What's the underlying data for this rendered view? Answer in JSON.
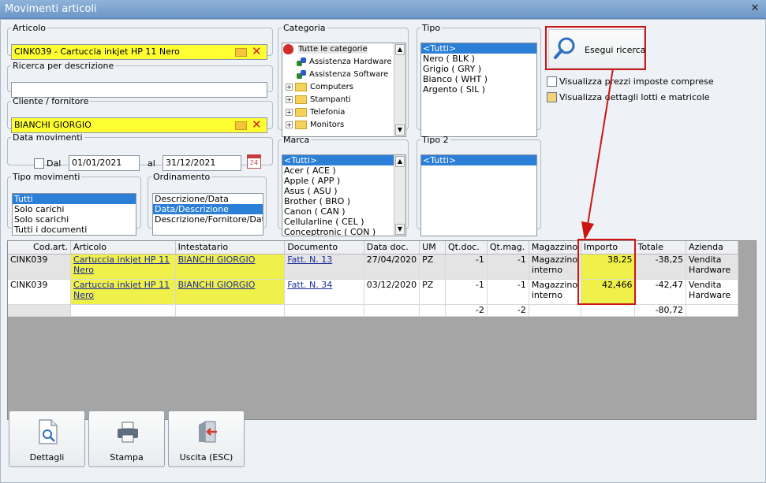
{
  "window": {
    "title": "Movimenti articoli",
    "close_glyph": "✕"
  },
  "articolo": {
    "legend": "Articolo",
    "value": "CINK039 - Cartuccia inkjet HP 11 Nero"
  },
  "descrizione": {
    "legend": "Ricerca per descrizione",
    "value": ""
  },
  "cliente": {
    "legend": "Cliente / fornitore",
    "value": "BIANCHI GIORGIO"
  },
  "data": {
    "legend": "Data movimenti",
    "dal_label": "Dal",
    "from": "01/01/2021",
    "al_label": "al",
    "to": "31/12/2021",
    "calendar_label": "24"
  },
  "tipo_movimenti": {
    "legend": "Tipo movimenti",
    "items": [
      "Tutti",
      "Solo carichi",
      "Solo scarichi",
      "Tutti i documenti"
    ],
    "selected": 0
  },
  "ordinamento": {
    "legend": "Ordinamento",
    "items": [
      "Descrizione/Data",
      "Data/Descrizione",
      "Descrizione/Fornitore/Data"
    ],
    "selected": 1
  },
  "categoria": {
    "legend": "Categoria",
    "root": "Tutte le categorie",
    "items": [
      "Assistenza Hardware",
      "Assistenza Software",
      "Computers",
      "Stampanti",
      "Telefonia",
      "Monitors"
    ]
  },
  "marca": {
    "legend": "Marca",
    "items": [
      "<Tutti>",
      "Acer ( ACE )",
      "Apple ( APP )",
      "Asus ( ASU )",
      "Brother ( BRO )",
      "Canon ( CAN )",
      "Cellularline ( CEL )",
      "Conceptronic ( CON )"
    ]
  },
  "tipo": {
    "legend": "Tipo",
    "items": [
      "<Tutti>",
      "Nero ( BLK )",
      "Grigio ( GRY )",
      "Bianco ( WHT )",
      "Argento ( SIL )"
    ]
  },
  "tipo2": {
    "legend": "Tipo 2",
    "items": [
      "<Tutti>"
    ]
  },
  "search": {
    "label": "Esegui ricerca"
  },
  "options": {
    "prezzi": "Visualizza prezzi imposte comprese",
    "dettagli": "Visualizza dettagli lotti e matricole"
  },
  "grid": {
    "columns": [
      "Cod.art.",
      "Articolo",
      "Intestatario",
      "Documento",
      "Data doc.",
      "UM",
      "Qt.doc.",
      "Qt.mag.",
      "Magazzino",
      "Importo",
      "Totale",
      "Azienda"
    ],
    "rows": [
      [
        "CINK039",
        "Cartuccia inkjet HP 11 Nero",
        "BIANCHI GIORGIO",
        "Fatt. N. 13",
        "27/04/2020",
        "PZ",
        "-1",
        "-1",
        "Magazzino interno",
        "38,25",
        "-38,25",
        "Vendita Hardware"
      ],
      [
        "CINK039",
        "Cartuccia inkjet HP 11 Nero",
        "BIANCHI GIORGIO",
        "Fatt. N. 34",
        "03/12/2020",
        "PZ",
        "-1",
        "-1",
        "Magazzino interno",
        "42,466",
        "-42,47",
        "Vendita Hardware"
      ]
    ],
    "totals": {
      "qt_doc": "-2",
      "qt_mag": "-2",
      "totale": "-80,72"
    }
  },
  "buttons": {
    "dettagli": "Dettagli",
    "stampa": "Stampa",
    "uscita": "Uscita (ESC)"
  },
  "colors": {
    "highlight": "#ffff33",
    "selection": "#2c7fd6",
    "annotation": "#cc1515"
  }
}
